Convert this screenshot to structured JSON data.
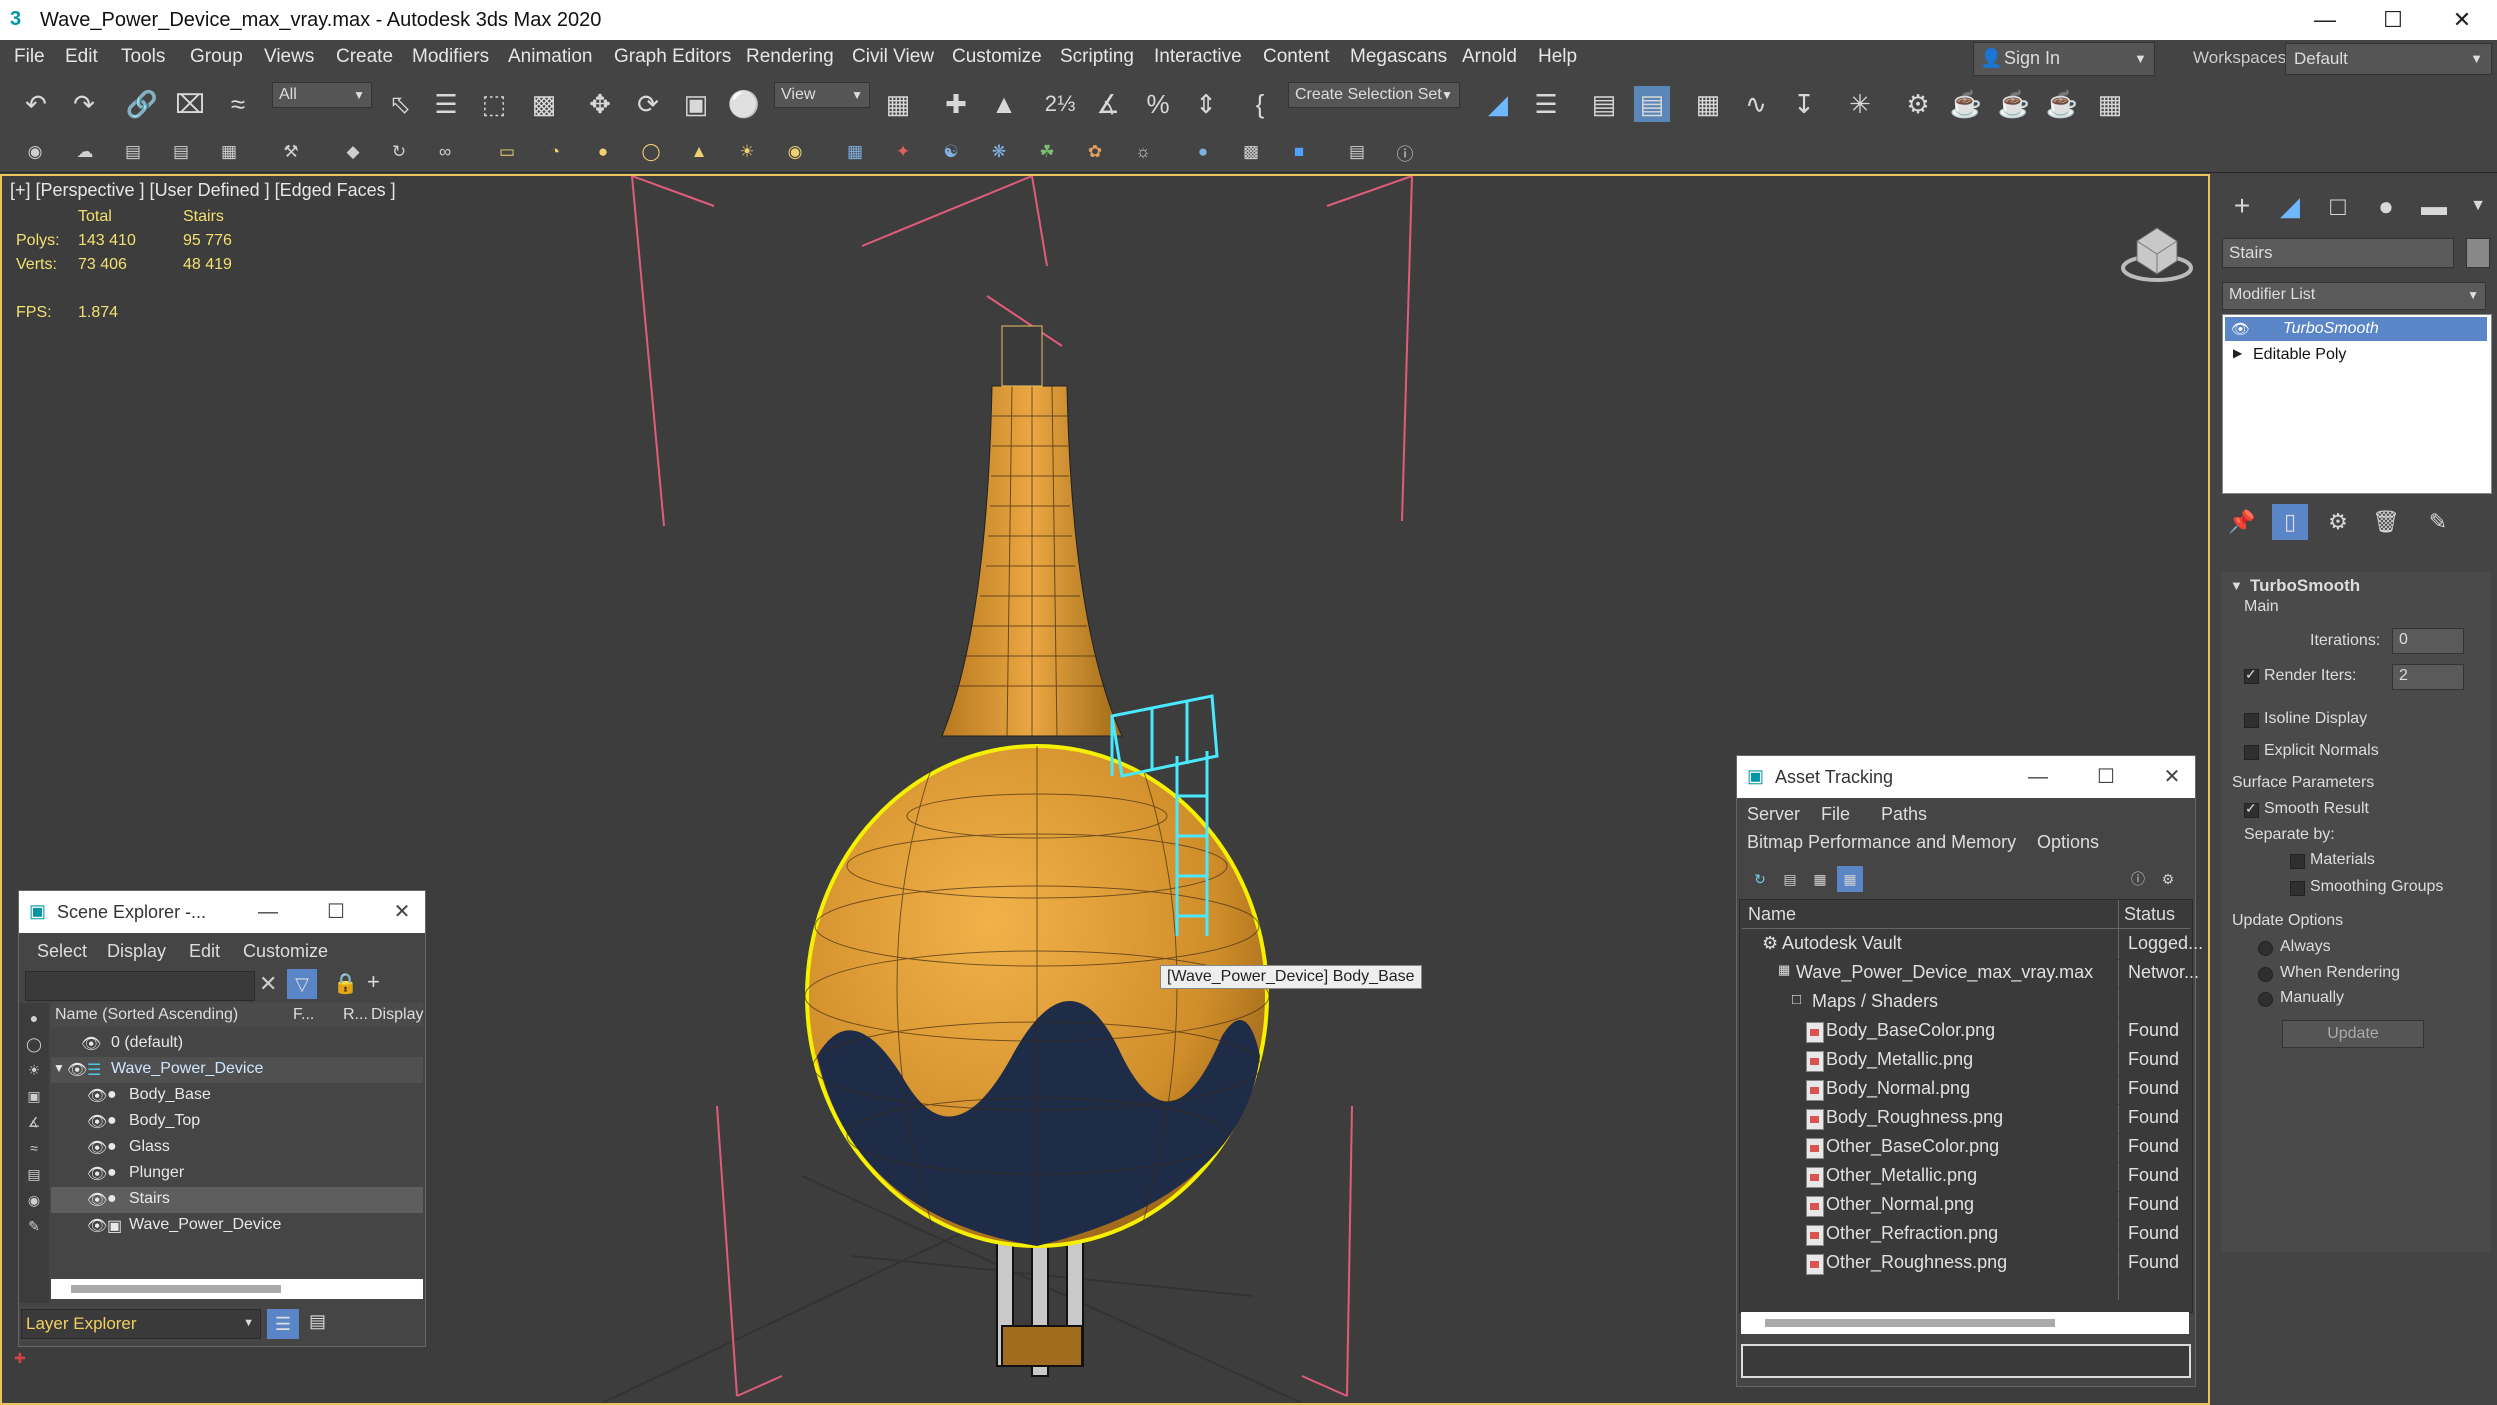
{
  "window": {
    "title": "Wave_Power_Device_max_vray.max - Autodesk 3ds Max 2020"
  },
  "menu": [
    "File",
    "Edit",
    "Tools",
    "Group",
    "Views",
    "Create",
    "Modifiers",
    "Animation",
    "Graph Editors",
    "Rendering",
    "Civil View",
    "Customize",
    "Scripting",
    "Interactive",
    "Content",
    "Megascans",
    "Arnold",
    "Help"
  ],
  "signin": {
    "label": "Sign In"
  },
  "workspaces": {
    "label": "Workspaces:",
    "value": "Default"
  },
  "toolbar": {
    "filter_value": "All",
    "refcoord_value": "View",
    "selection_set_placeholder": "Create Selection Set"
  },
  "viewport": {
    "label": "[+] [Perspective ] [User Defined ] [Edged Faces ]",
    "stats": {
      "col_total": "Total",
      "col_selected": "Stairs",
      "polys_label": "Polys:",
      "polys_total": "143 410",
      "polys_selected": "95 776",
      "verts_label": "Verts:",
      "verts_total": "73 406",
      "verts_selected": "48 419",
      "fps_label": "FPS:",
      "fps_value": "1.874"
    },
    "tooltip": "[Wave_Power_Device] Body_Base"
  },
  "command_panel": {
    "object_name": "Stairs",
    "modifier_list_label": "Modifier List",
    "stack": [
      "TurboSmooth",
      "Editable Poly"
    ],
    "rollout_title": "TurboSmooth",
    "main_label": "Main",
    "iterations_label": "Iterations:",
    "iterations_value": "0",
    "render_iters_label": "Render Iters:",
    "render_iters_value": "2",
    "isoline_label": "Isoline Display",
    "explicit_normals_label": "Explicit Normals",
    "surface_params_label": "Surface Parameters",
    "smooth_result_label": "Smooth Result",
    "separate_by_label": "Separate by:",
    "materials_label": "Materials",
    "smoothing_groups_label": "Smoothing Groups",
    "update_options_label": "Update Options",
    "always_label": "Always",
    "when_rendering_label": "When Rendering",
    "manually_label": "Manually",
    "update_button": "Update"
  },
  "scene_explorer": {
    "title": "Scene Explorer -...",
    "menu": [
      "Select",
      "Display",
      "Edit",
      "Customize"
    ],
    "col_name": "Name (Sorted Ascending)",
    "col_f": "F...",
    "col_r": "R...",
    "col_display": "Display",
    "rows": [
      "0 (default)",
      "Wave_Power_Device",
      "Body_Base",
      "Body_Top",
      "Glass",
      "Plunger",
      "Stairs",
      "Wave_Power_Device"
    ],
    "layer_explorer": "Layer Explorer"
  },
  "asset_tracking": {
    "title": "Asset Tracking",
    "menu1": [
      "Server",
      "File",
      "Paths"
    ],
    "menu2": [
      "Bitmap Performance and Memory",
      "Options"
    ],
    "col_name": "Name",
    "col_status": "Status",
    "rows": [
      {
        "name": "Autodesk Vault",
        "status": "Logged..."
      },
      {
        "name": "Wave_Power_Device_max_vray.max",
        "status": "Networ..."
      },
      {
        "name": "Maps / Shaders",
        "status": ""
      },
      {
        "name": "Body_BaseColor.png",
        "status": "Found"
      },
      {
        "name": "Body_Metallic.png",
        "status": "Found"
      },
      {
        "name": "Body_Normal.png",
        "status": "Found"
      },
      {
        "name": "Body_Roughness.png",
        "status": "Found"
      },
      {
        "name": "Other_BaseColor.png",
        "status": "Found"
      },
      {
        "name": "Other_Metallic.png",
        "status": "Found"
      },
      {
        "name": "Other_Normal.png",
        "status": "Found"
      },
      {
        "name": "Other_Refraction.png",
        "status": "Found"
      },
      {
        "name": "Other_Roughness.png",
        "status": "Found"
      }
    ]
  }
}
